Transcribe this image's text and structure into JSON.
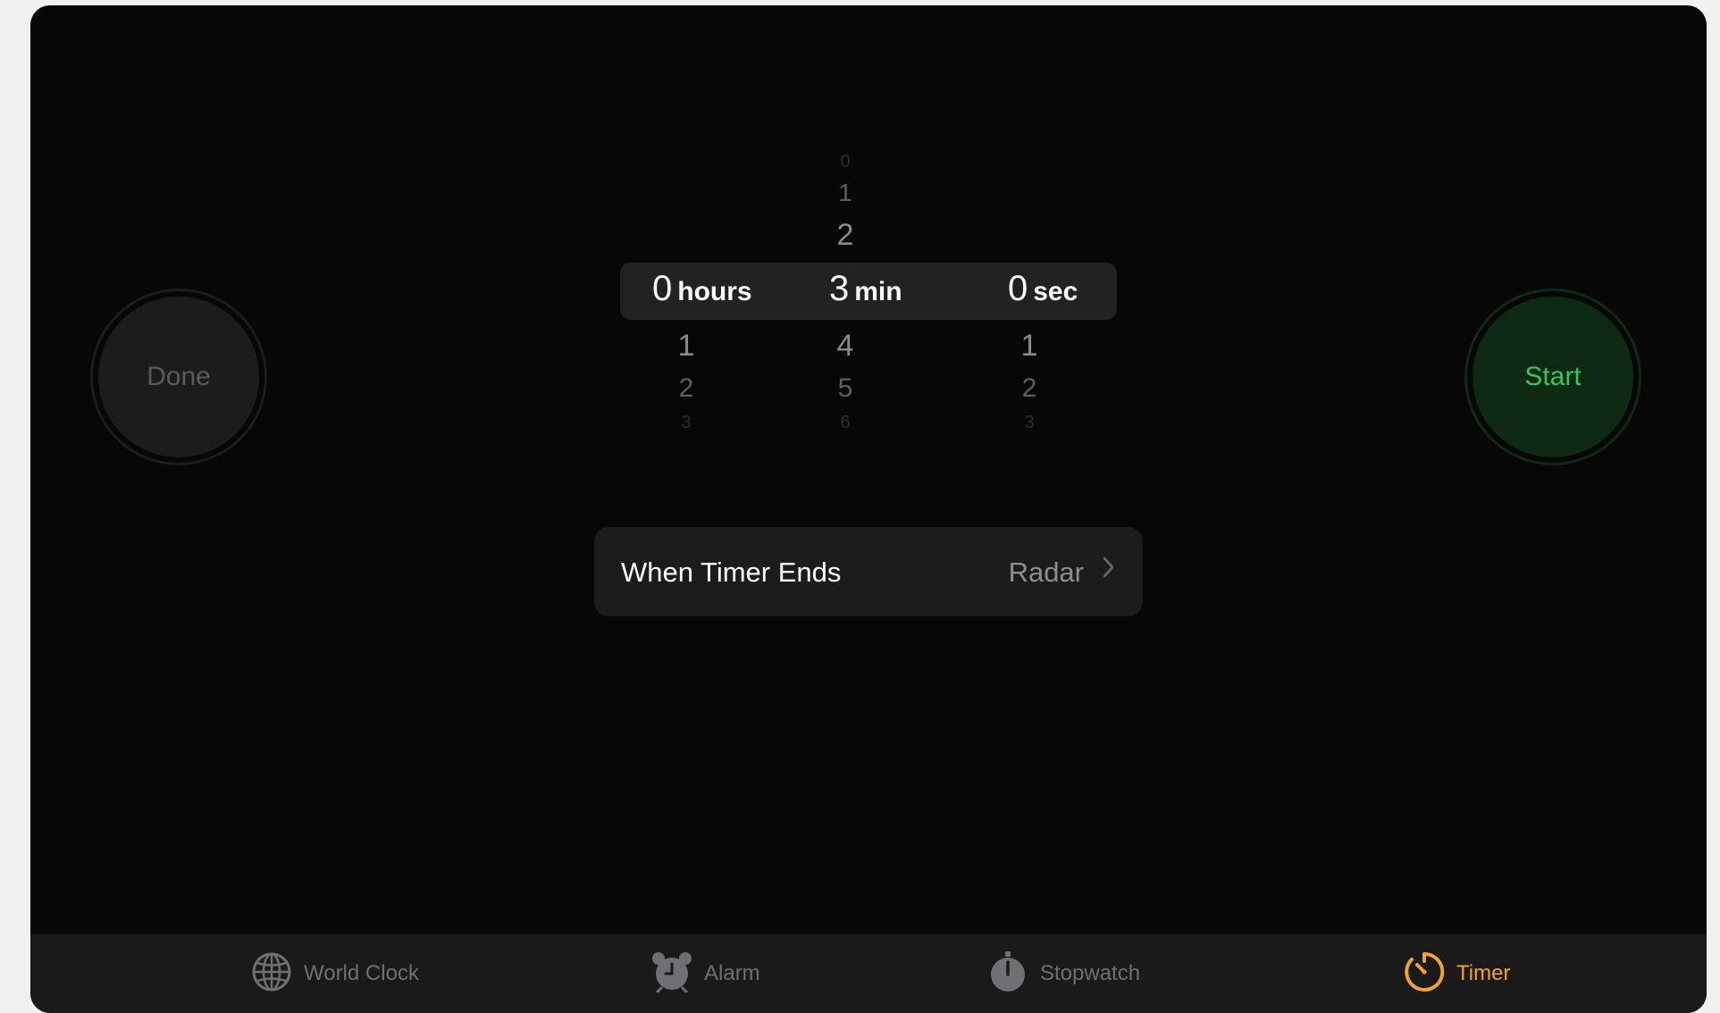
{
  "buttons": {
    "done": "Done",
    "start": "Start"
  },
  "picker": {
    "hours": {
      "above": [],
      "selected": "0",
      "unit": "hours",
      "below": [
        "1",
        "2",
        "3"
      ]
    },
    "minutes": {
      "above": [
        "0",
        "1",
        "2"
      ],
      "selected": "3",
      "unit": "min",
      "below": [
        "4",
        "5",
        "6"
      ]
    },
    "seconds": {
      "above": [],
      "selected": "0",
      "unit": "sec",
      "below": [
        "1",
        "2",
        "3"
      ]
    }
  },
  "when_timer_ends": {
    "label": "When Timer Ends",
    "value": "Radar"
  },
  "tabbar": {
    "tabs": [
      {
        "label": "World Clock",
        "icon": "globe-icon",
        "active": false
      },
      {
        "label": "Alarm",
        "icon": "alarm-clock-icon",
        "active": false
      },
      {
        "label": "Stopwatch",
        "icon": "stopwatch-icon",
        "active": false
      },
      {
        "label": "Timer",
        "icon": "timer-icon",
        "active": true
      }
    ]
  },
  "colors": {
    "accent": "#f1a235",
    "start_green": "#32c75a",
    "background": "#070707"
  }
}
